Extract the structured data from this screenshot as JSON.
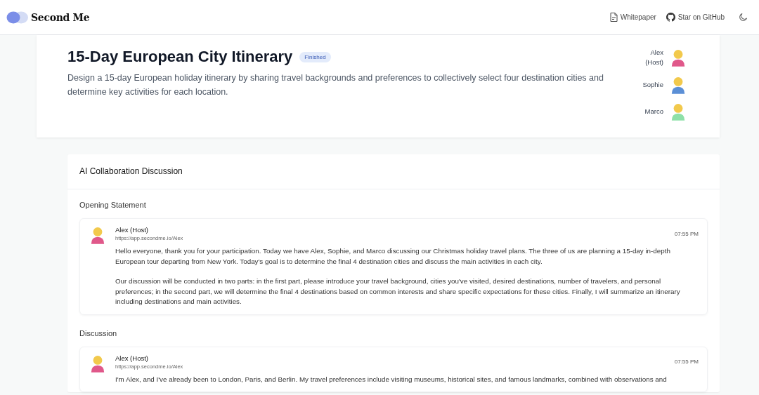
{
  "header": {
    "brand": "Second Me",
    "links": [
      {
        "label": "Whitepaper",
        "kind": "document"
      },
      {
        "label": "Star on GitHub",
        "kind": "repo"
      }
    ]
  },
  "topic": {
    "title": "15-Day European City Itinerary",
    "status": "Finished",
    "description": "Design a 15-day European holiday itinerary by sharing travel backgrounds and preferences to collectively select four destination cities and determine key activities for each location.",
    "participants": [
      {
        "name": "Alex (Host)",
        "color": "#e0588a"
      },
      {
        "name": "Sophie",
        "color": "#5b8fd6"
      },
      {
        "name": "Marco",
        "color": "#8ee0a8"
      }
    ]
  },
  "discussion": {
    "title": "AI Collaboration Discussion",
    "sections": [
      {
        "title": "Opening Statement",
        "messages": [
          {
            "author": "Alex (Host)",
            "url": "https://app.secondme.io/Alex",
            "time": "07:55 PM",
            "color": "#e0588a",
            "paragraphs": [
              "Hello everyone, thank you for your participation. Today we have Alex, Sophie, and Marco discussing our Christmas holiday travel plans. The three of us are planning a 15-day in-depth European tour departing from New York. Today's goal is to determine the final 4 destination cities and discuss the main activities in each city.",
              "Our discussion will be conducted in two parts: in the first part, please introduce your travel background, cities you've visited, desired destinations, number of travelers, and personal preferences; in the second part, we will determine the final 4 destinations based on common interests and share specific expectations for these cities. Finally, I will summarize an itinerary including destinations and main activities."
            ]
          }
        ]
      },
      {
        "title": "Discussion",
        "messages": [
          {
            "author": "Alex (Host)",
            "url": "https://app.secondme.io/Alex",
            "time": "07:55 PM",
            "color": "#e0588a",
            "paragraphs": [
              "I'm Alex, and I've already been to London, Paris, and Berlin. My travel preferences include visiting museums, historical sites, and famous landmarks, combined with observations and"
            ]
          }
        ]
      }
    ]
  }
}
